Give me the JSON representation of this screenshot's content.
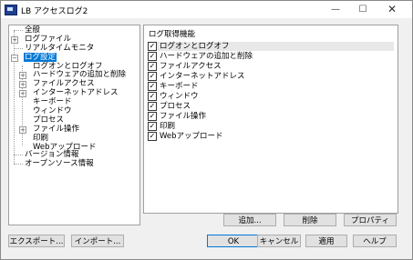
{
  "window": {
    "title": "LB アクセスログ2",
    "minimize_glyph": "—",
    "maximize_glyph": "☐",
    "close_glyph": "✕"
  },
  "tree": {
    "items": [
      {
        "label": "全般"
      },
      {
        "label": "ログファイル",
        "expander": "+"
      },
      {
        "label": "リアルタイムモニタ"
      },
      {
        "label": "ログ設定",
        "expander": "−",
        "selected": true
      },
      {
        "label": "ログオンとログオフ"
      },
      {
        "label": "ハードウェアの追加と削除",
        "expander": "+"
      },
      {
        "label": "ファイルアクセス",
        "expander": "+"
      },
      {
        "label": "インターネットアドレス",
        "expander": "+"
      },
      {
        "label": "キーボード"
      },
      {
        "label": "ウィンドウ"
      },
      {
        "label": "プロセス"
      },
      {
        "label": "ファイル操作",
        "expander": "+"
      },
      {
        "label": "印刷"
      },
      {
        "label": "Webアップロード"
      },
      {
        "label": "バージョン情報"
      },
      {
        "label": "オープンソース情報"
      }
    ]
  },
  "settings": {
    "title": "ログ取得機能",
    "items": [
      {
        "label": "ログオンとログオフ",
        "checked": true
      },
      {
        "label": "ハードウェアの追加と削除",
        "checked": true
      },
      {
        "label": "ファイルアクセス",
        "checked": true
      },
      {
        "label": "インターネットアドレス",
        "checked": true
      },
      {
        "label": "キーボード",
        "checked": true
      },
      {
        "label": "ウィンドウ",
        "checked": true
      },
      {
        "label": "プロセス",
        "checked": true
      },
      {
        "label": "ファイル操作",
        "checked": true
      },
      {
        "label": "印刷",
        "checked": true
      },
      {
        "label": "Webアップロード",
        "checked": true
      }
    ],
    "check_glyph": "✓"
  },
  "panel_buttons": {
    "add": "追加...",
    "delete": "削除",
    "properties": "プロパティ"
  },
  "footer_buttons": {
    "export": "エクスポート...",
    "import": "インポート...",
    "ok": "OK",
    "cancel": "キャンセル",
    "apply": "適用",
    "help": "ヘルプ"
  }
}
